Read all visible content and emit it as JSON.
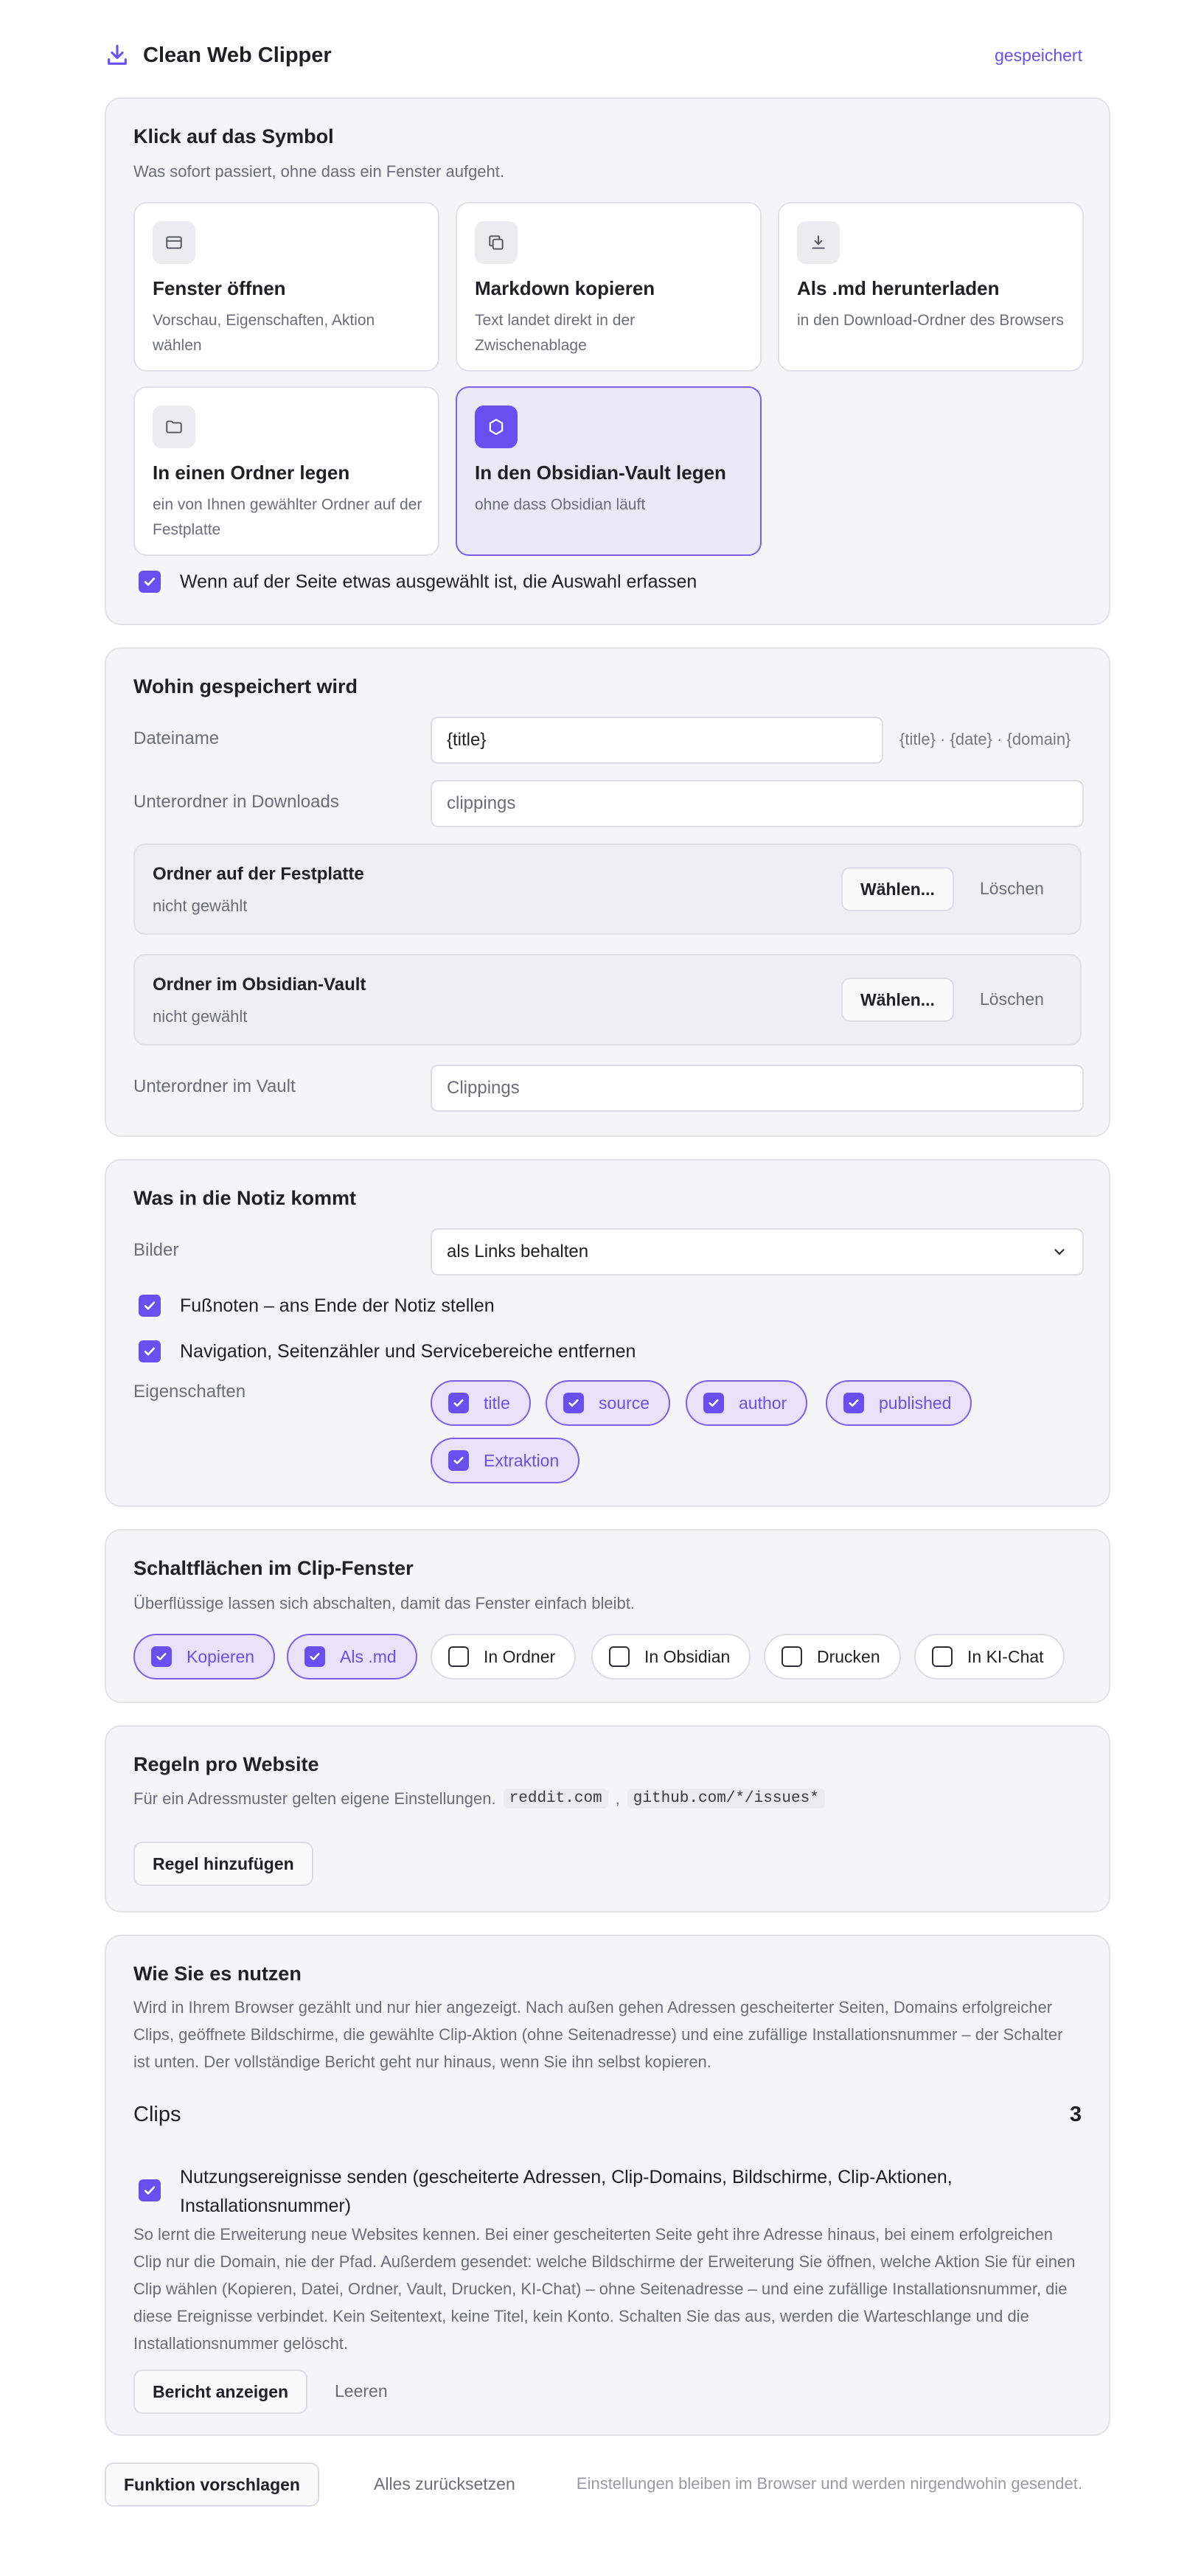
{
  "header": {
    "app_name": "Clean Web Clipper",
    "status": "gespeichert"
  },
  "click_section": {
    "title": "Klick auf das Symbol",
    "subtitle": "Was sofort passiert, ohne dass ein Fenster aufgeht.",
    "options": [
      {
        "title": "Fenster öffnen",
        "desc": "Vorschau, Eigenschaften, Aktion wählen",
        "icon": "window-icon",
        "selected": false
      },
      {
        "title": "Markdown kopieren",
        "desc": "Text landet direkt in der Zwischenablage",
        "icon": "copy-icon",
        "selected": false
      },
      {
        "title": "Als .md herunterladen",
        "desc": "in den Download-Ordner des Browsers",
        "icon": "download-icon",
        "selected": false
      },
      {
        "title": "In einen Ordner legen",
        "desc": "ein von Ihnen gewählter Ordner auf der Festplatte",
        "icon": "folder-icon",
        "selected": false
      },
      {
        "title": "In den Obsidian-Vault legen",
        "desc": "ohne dass Obsidian läuft",
        "icon": "obsidian-icon",
        "selected": true
      }
    ],
    "selection_checkbox": "Wenn auf der Seite etwas ausgewählt ist, die Auswahl erfassen"
  },
  "save_section": {
    "title": "Wohin gespeichert wird",
    "filename_label": "Dateiname",
    "filename_value": "{title}",
    "filename_hint": "{title} · {date} · {domain}",
    "downloads_subfolder_label": "Unterordner in Downloads",
    "downloads_subfolder_placeholder": "clippings",
    "disk_folder": {
      "title": "Ordner auf der Festplatte",
      "status": "nicht gewählt",
      "choose": "Wählen...",
      "clear": "Löschen"
    },
    "vault_folder": {
      "title": "Ordner im Obsidian-Vault",
      "status": "nicht gewählt",
      "choose": "Wählen...",
      "clear": "Löschen"
    },
    "vault_subfolder_label": "Unterordner im Vault",
    "vault_subfolder_placeholder": "Clippings"
  },
  "note_section": {
    "title": "Was in die Notiz kommt",
    "images_label": "Bilder",
    "images_value": "als Links behalten",
    "footnotes": "Fußnoten – ans Ende der Notiz stellen",
    "navigation": "Navigation, Seitenzähler und Servicebereiche entfernen",
    "properties_label": "Eigenschaften",
    "properties": [
      "title",
      "source",
      "author",
      "published",
      "Extraktion"
    ]
  },
  "buttons_section": {
    "title": "Schaltflächen im Clip-Fenster",
    "subtitle": "Überflüssige lassen sich abschalten, damit das Fenster einfach bleibt.",
    "items": [
      {
        "label": "Kopieren",
        "on": true
      },
      {
        "label": "Als .md",
        "on": true
      },
      {
        "label": "In Ordner",
        "on": false
      },
      {
        "label": "In Obsidian",
        "on": false
      },
      {
        "label": "Drucken",
        "on": false
      },
      {
        "label": "In KI-Chat",
        "on": false
      }
    ]
  },
  "rules_section": {
    "title": "Regeln pro Website",
    "subtitle": "Für ein Adressmuster gelten eigene Einstellungen.",
    "example1": "reddit.com",
    "example2": "github.com/*/issues*",
    "add_rule": "Regel hinzufügen"
  },
  "usage_section": {
    "title": "Wie Sie es nutzen",
    "intro": "Wird in Ihrem Browser gezählt und nur hier angezeigt. Nach außen gehen Adressen gescheiterter Seiten, Domains erfolgreicher Clips, geöffnete Bildschirme, die gewählte Clip-Aktion (ohne Seitenadresse) und eine zufällige Installationsnummer – der Schalter ist unten. Der vollständige Bericht geht nur hinaus, wenn Sie ihn selbst kopieren.",
    "clips_label": "Clips",
    "clips_count": "3",
    "telemetry_checkbox": "Nutzungsereignisse senden (gescheiterte Adressen, Clip-Domains, Bildschirme, Clip-Aktionen, Installationsnummer)",
    "telemetry_desc": "So lernt die Erweiterung neue Websites kennen. Bei einer gescheiterten Seite geht ihre Adresse hinaus, bei einem erfolgreichen Clip nur die Domain, nie der Pfad. Außerdem gesendet: welche Bildschirme der Erweiterung Sie öffnen, welche Aktion Sie für einen Clip wählen (Kopieren, Datei, Ordner, Vault, Drucken, KI-Chat) – ohne Seitenadresse – und eine zufällige Installationsnummer, die diese Ereignisse verbindet. Kein Seitentext, keine Titel, kein Konto. Schalten Sie das aus, werden die Warteschlange und die Installationsnummer gelöscht.",
    "show_report": "Bericht anzeigen",
    "clear": "Leeren"
  },
  "footer": {
    "suggest": "Funktion vorschlagen",
    "reset": "Alles zurücksetzen",
    "note": "Einstellungen bleiben im Browser und werden nirgendwohin gesendet."
  },
  "colors": {
    "accent": "#6a4ff0",
    "section_bg": "#f5f5f7",
    "selected_bg": "#ece9f7",
    "muted_text": "#6d6d78"
  }
}
